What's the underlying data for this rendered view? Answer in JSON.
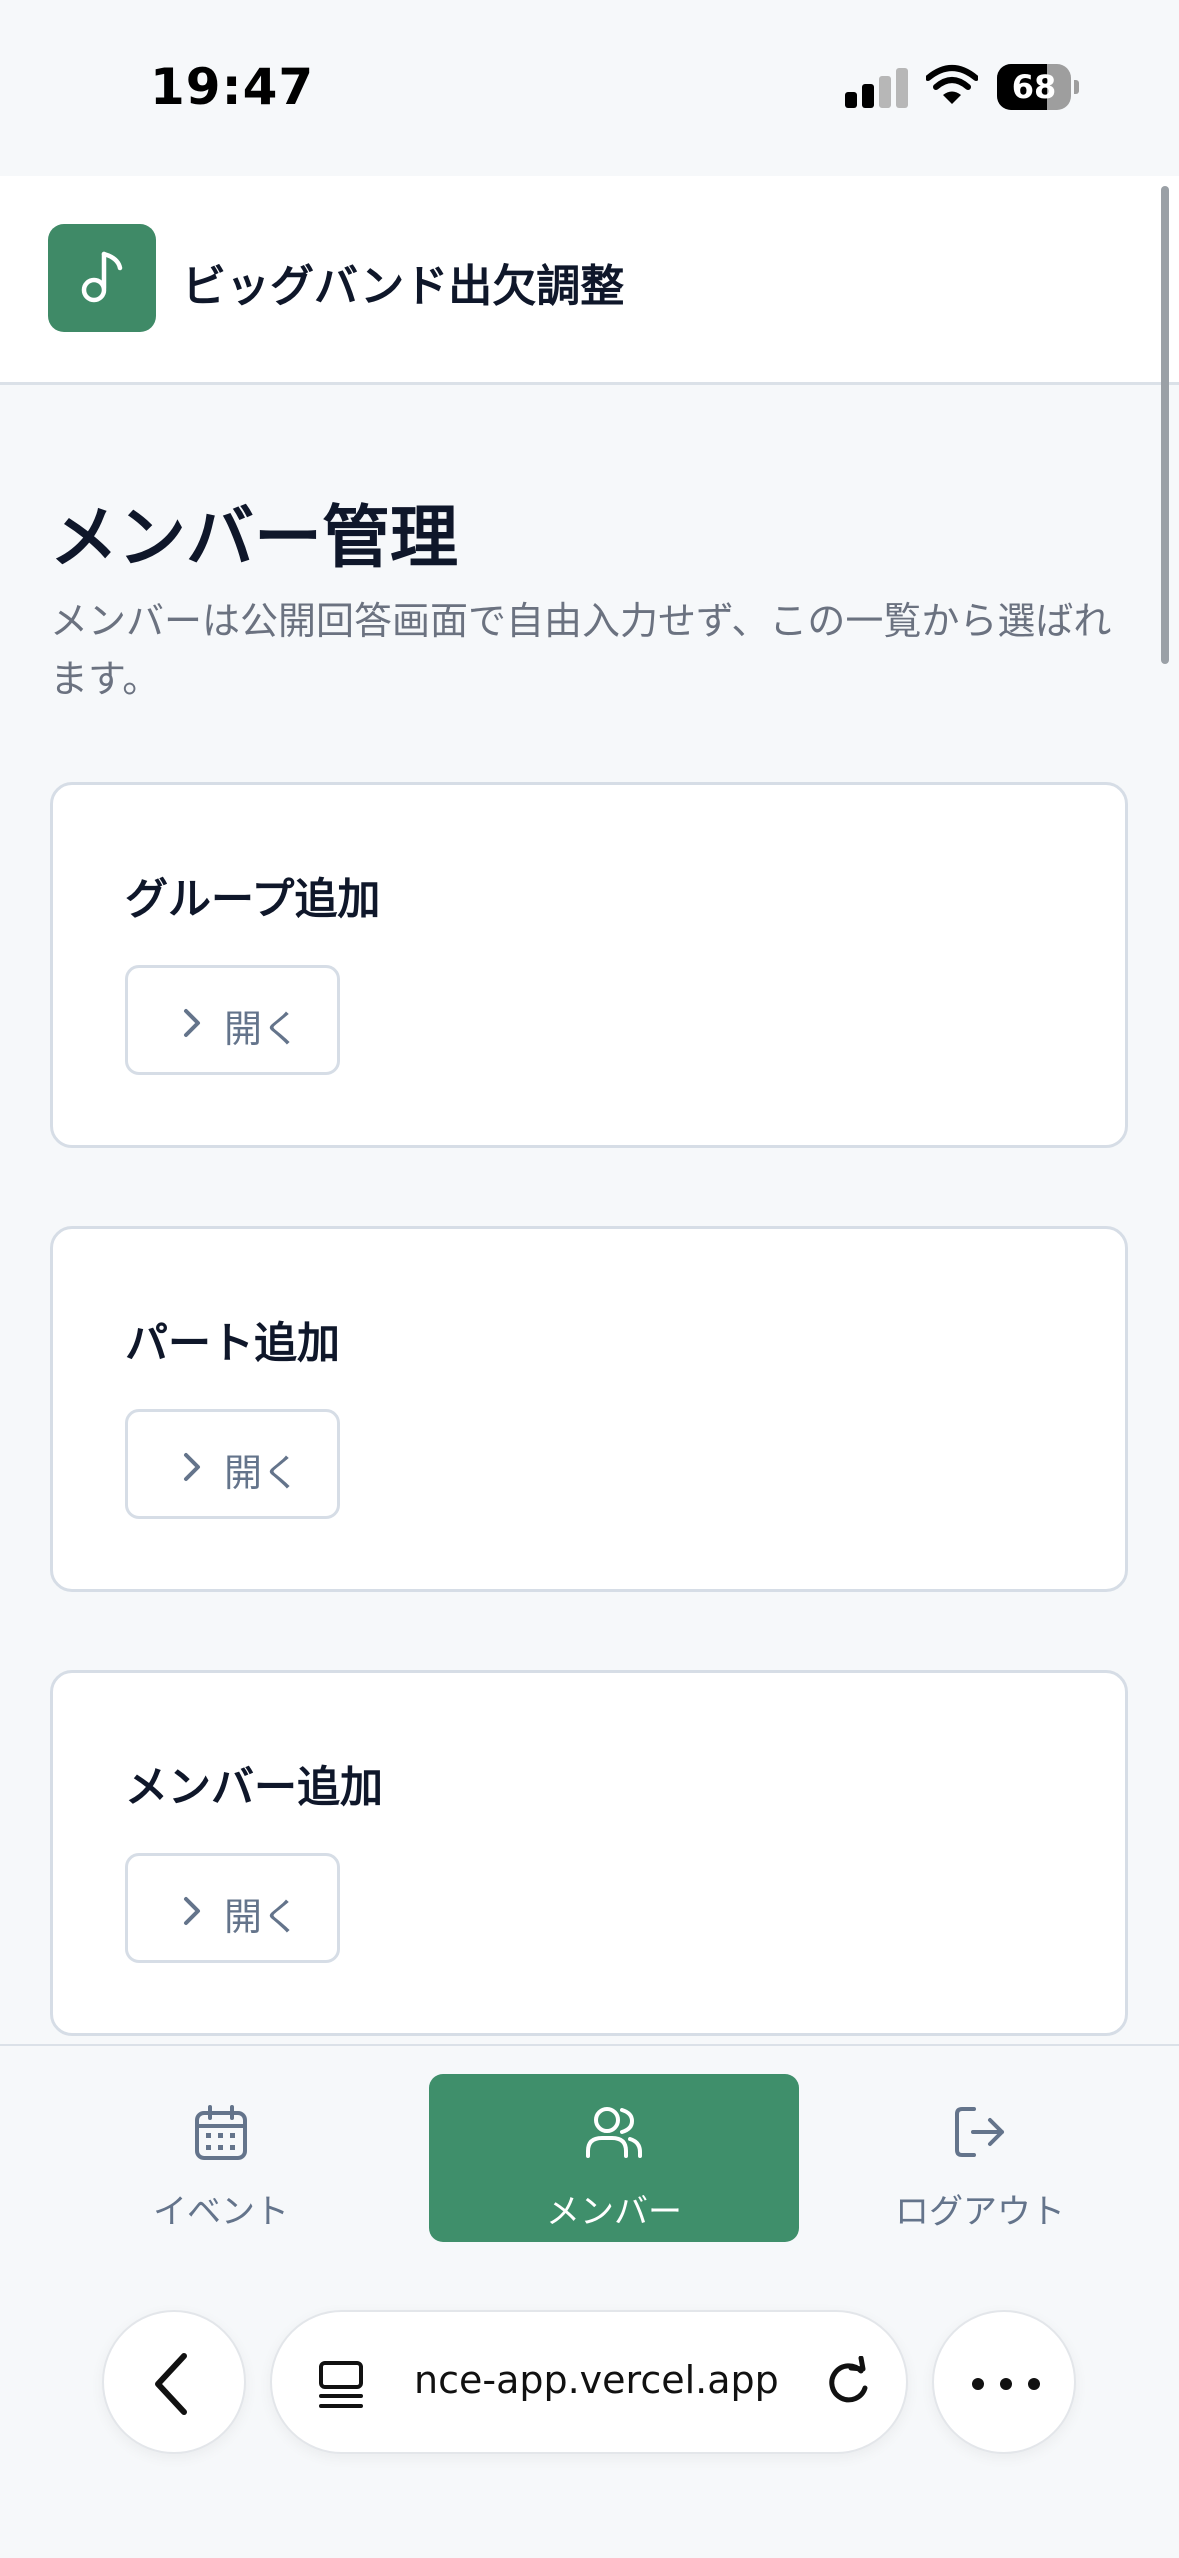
{
  "status_bar": {
    "time": "19:47",
    "battery": 68
  },
  "header": {
    "app_title": "ビッグバンド出欠調整",
    "logo_icon": "music-note-icon",
    "accent": "#3f8a67"
  },
  "page": {
    "title": "メンバー管理",
    "description": "メンバーは公開回答画面で自由入力せず、この一覧から選ばれます。"
  },
  "cards": [
    {
      "title": "グループ追加",
      "button_label": "開く"
    },
    {
      "title": "パート追加",
      "button_label": "開く"
    },
    {
      "title": "メンバー追加",
      "button_label": "開く"
    }
  ],
  "nav": {
    "items": [
      {
        "label": "イベント",
        "icon": "calendar-icon",
        "active": false
      },
      {
        "label": "メンバー",
        "icon": "users-icon",
        "active": true
      },
      {
        "label": "ログアウト",
        "icon": "logout-icon",
        "active": false
      }
    ],
    "active_color": "#3f8f6b"
  },
  "browser": {
    "url": "nce-app.vercel.app"
  }
}
